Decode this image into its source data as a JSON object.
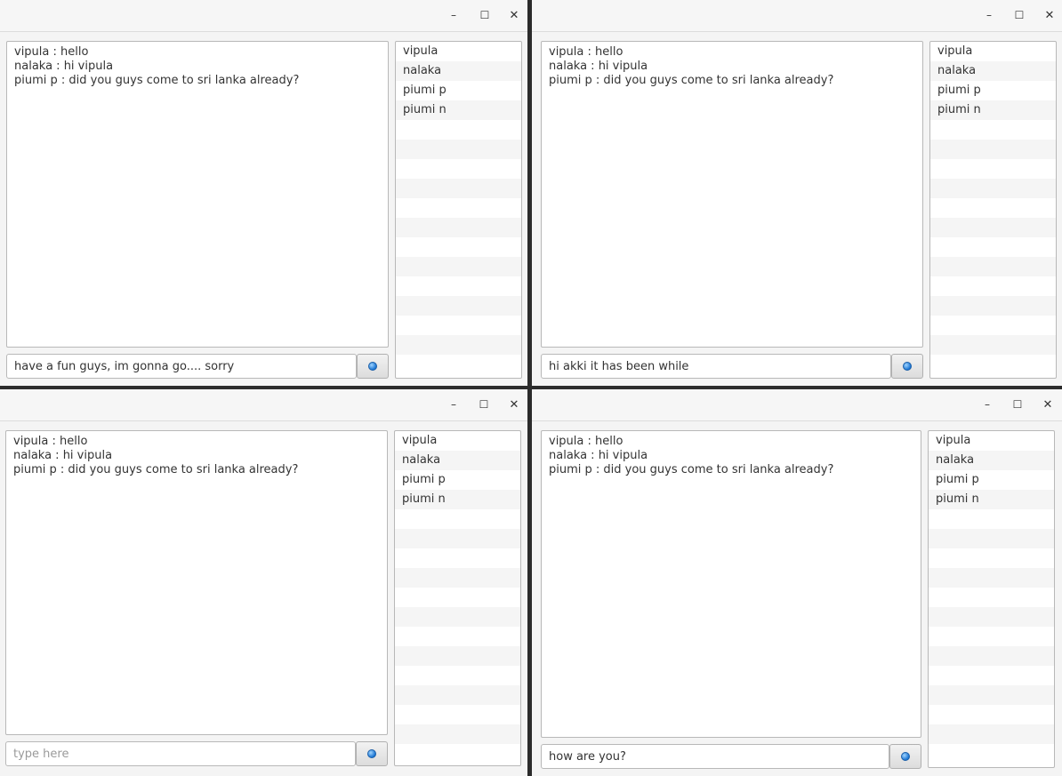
{
  "window_controls": {
    "minimize": "–",
    "maximize": "☐",
    "close": "✕"
  },
  "chat_messages": [
    "vipula : hello",
    "nalaka : hi vipula",
    "piumi p : did you guys come to sri lanka already?"
  ],
  "users": [
    "vipula",
    "nalaka",
    "piumi p",
    "piumi n"
  ],
  "windows": [
    {
      "input_value": "have a fun guys, im gonna go.... sorry",
      "input_placeholder": "type here"
    },
    {
      "input_value": "hi akki it has been while",
      "input_placeholder": "type here"
    },
    {
      "input_value": "",
      "input_placeholder": "type here"
    },
    {
      "input_value": "how are you?",
      "input_placeholder": "type here"
    }
  ],
  "send_button_icon": "send-icon"
}
